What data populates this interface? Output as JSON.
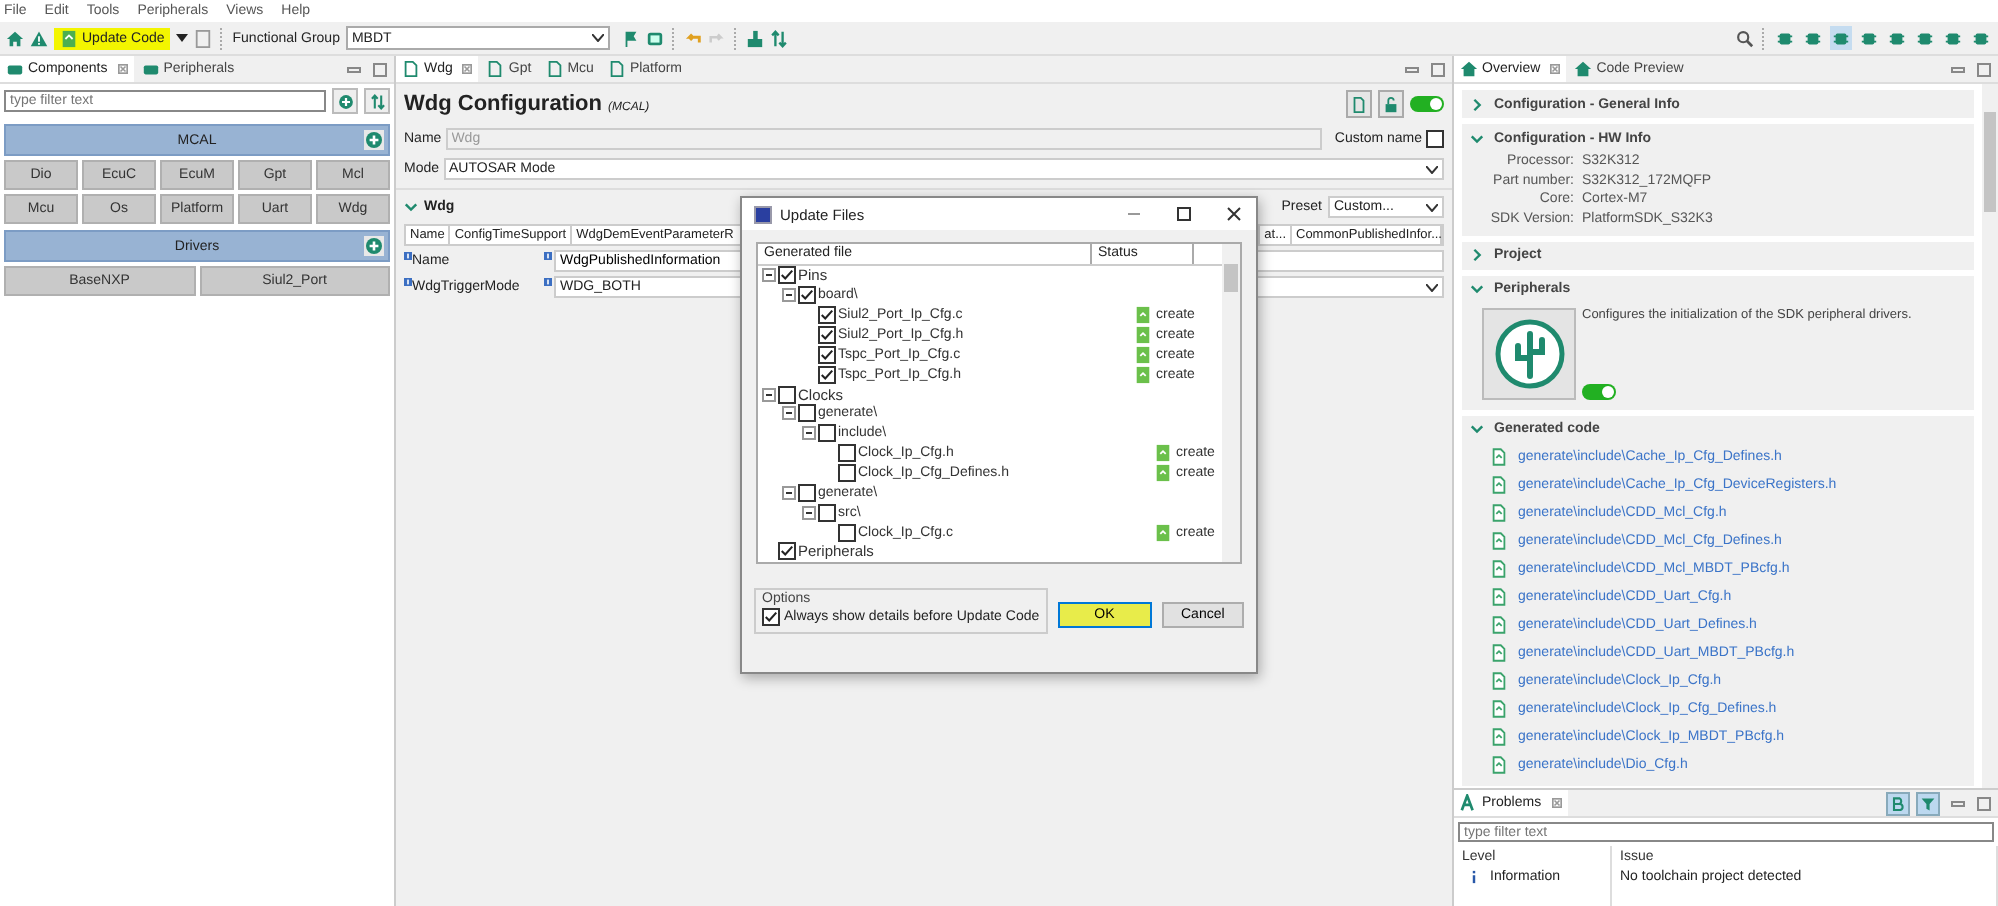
{
  "menu": [
    "File",
    "Edit",
    "Tools",
    "Peripherals",
    "Views",
    "Help"
  ],
  "toolbar": {
    "update_button": "Update Code",
    "functional_group_label": "Functional Group",
    "functional_group_value": "MBDT",
    "view_icons": [
      {
        "selected": false
      },
      {
        "selected": false
      },
      {
        "selected": true
      },
      {
        "selected": false
      },
      {
        "selected": false
      },
      {
        "selected": false
      },
      {
        "selected": false
      },
      {
        "selected": false
      }
    ]
  },
  "left_panel": {
    "tabs": [
      {
        "label": "Components",
        "selected": true
      },
      {
        "label": "Peripherals",
        "selected": false
      }
    ],
    "filter_placeholder": "type filter text",
    "groups": [
      {
        "title": "MCAL",
        "rows": [
          [
            "Dio",
            "EcuC",
            "EcuM",
            "Gpt",
            "Mcl"
          ],
          [
            "Mcu",
            "Os",
            "Platform",
            "Uart",
            "Wdg"
          ]
        ]
      },
      {
        "title": "Drivers",
        "rows": [
          [
            "BaseNXP",
            "Siul2_Port"
          ]
        ]
      }
    ]
  },
  "editor": {
    "tabs": [
      {
        "label": "Wdg",
        "selected": true
      },
      {
        "label": "Gpt",
        "selected": false
      },
      {
        "label": "Mcu",
        "selected": false
      },
      {
        "label": "Platform",
        "selected": false
      }
    ],
    "title": "Wdg Configuration",
    "subtitle": "(MCAL)",
    "enabled": true,
    "name_label": "Name",
    "name_value": "Wdg",
    "custom_name_label": "Custom name",
    "custom_name_checked": false,
    "mode_label": "Mode",
    "mode_value": "AUTOSAR Mode",
    "section": "Wdg",
    "section_expanded": true,
    "preset_label": "Preset",
    "preset_value": "Custom...",
    "columns": [
      "Name",
      "ConfigTimeSupport",
      "WdgDemEventParameterR",
      "at...",
      "CommonPublishedInfor..."
    ],
    "rows": [
      {
        "label": "Name",
        "value": "WdgPublishedInformation",
        "kind": "text"
      },
      {
        "label": "WdgTriggerMode",
        "value": "WDG_BOTH",
        "kind": "select"
      }
    ]
  },
  "dialog": {
    "title": "Update Files",
    "columns": [
      "Generated file",
      "Status"
    ],
    "tree": [
      {
        "label": "Pins",
        "checked": true,
        "children": [
          {
            "label": "board\\",
            "checked": true,
            "children": [
              {
                "label": "Siul2_Port_Ip_Cfg.c",
                "checked": true,
                "status": "create"
              },
              {
                "label": "Siul2_Port_Ip_Cfg.h",
                "checked": true,
                "status": "create"
              },
              {
                "label": "Tspc_Port_Ip_Cfg.c",
                "checked": true,
                "status": "create"
              },
              {
                "label": "Tspc_Port_Ip_Cfg.h",
                "checked": true,
                "status": "create"
              }
            ]
          }
        ]
      },
      {
        "label": "Clocks",
        "checked": false,
        "children": [
          {
            "label": "generate\\",
            "checked": false,
            "children": [
              {
                "label": "include\\",
                "checked": false,
                "children": [
                  {
                    "label": "Clock_Ip_Cfg.h",
                    "checked": false,
                    "status": "create"
                  },
                  {
                    "label": "Clock_Ip_Cfg_Defines.h",
                    "checked": false,
                    "status": "create"
                  }
                ]
              }
            ]
          },
          {
            "label": "generate\\",
            "checked": false,
            "children": [
              {
                "label": "src\\",
                "checked": false,
                "children": [
                  {
                    "label": "Clock_Ip_Cfg.c",
                    "checked": false,
                    "status": "create"
                  }
                ]
              }
            ]
          }
        ]
      },
      {
        "label": "Peripherals",
        "checked": true
      }
    ],
    "options_label": "Options",
    "always_show_label": "Always show details before Update Code",
    "always_show_checked": true,
    "buttons": [
      "OK",
      "Cancel"
    ]
  },
  "overview": {
    "tabs": [
      {
        "label": "Overview",
        "selected": true
      },
      {
        "label": "Code Preview",
        "selected": false
      }
    ],
    "sections": [
      {
        "kind": "plain",
        "title": "Configuration - General Info",
        "expanded": false
      },
      {
        "kind": "info",
        "title": "Configuration - HW Info",
        "expanded": true,
        "fields": [
          {
            "label": "Processor:",
            "value": "S32K312"
          },
          {
            "label": "Part number:",
            "value": "S32K312_172MQFP"
          },
          {
            "label": "Core:",
            "value": "Cortex-M7"
          },
          {
            "label": "SDK Version:",
            "value": "PlatformSDK_S32K3"
          }
        ]
      },
      {
        "kind": "plain",
        "title": "Project",
        "expanded": false
      },
      {
        "kind": "peripherals",
        "title": "Peripherals",
        "expanded": true,
        "description": "Configures the initialization of the SDK peripheral drivers.",
        "enabled": true
      },
      {
        "kind": "files",
        "title": "Generated code",
        "expanded": true,
        "files": [
          "generate\\include\\Cache_Ip_Cfg_Defines.h",
          "generate\\include\\Cache_Ip_Cfg_DeviceRegisters.h",
          "generate\\include\\CDD_Mcl_Cfg.h",
          "generate\\include\\CDD_Mcl_Cfg_Defines.h",
          "generate\\include\\CDD_Mcl_MBDT_PBcfg.h",
          "generate\\include\\CDD_Uart_Cfg.h",
          "generate\\include\\CDD_Uart_Defines.h",
          "generate\\include\\CDD_Uart_MBDT_PBcfg.h",
          "generate\\include\\Clock_Ip_Cfg.h",
          "generate\\include\\Clock_Ip_Cfg_Defines.h",
          "generate\\include\\Clock_Ip_MBDT_PBcfg.h",
          "generate\\include\\Dio_Cfg.h"
        ]
      }
    ]
  },
  "problems": {
    "title": "Problems",
    "filter_placeholder": "type filter text",
    "columns": [
      "Level",
      "Issue"
    ],
    "rows": [
      {
        "level": "Information",
        "issue": "No toolchain project detected"
      }
    ]
  }
}
